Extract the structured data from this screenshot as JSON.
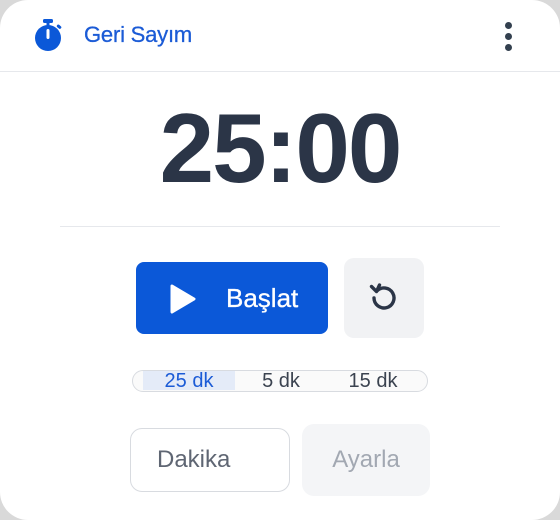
{
  "header": {
    "title": "Geri Sayım",
    "timer_icon": "stopwatch-icon",
    "menu_icon": "more-vertical-icon"
  },
  "timer": {
    "display": "25:00"
  },
  "controls": {
    "start_label": "Başlat",
    "start_icon": "play-icon",
    "reset_icon": "reset-icon"
  },
  "presets": {
    "items": [
      {
        "label": "25 dk",
        "active": true
      },
      {
        "label": "5 dk",
        "active": false
      },
      {
        "label": "15 dk",
        "active": false
      }
    ]
  },
  "custom": {
    "placeholder": "Dakika",
    "value": "",
    "set_label": "Ayarla"
  },
  "colors": {
    "accent": "#0b58d8",
    "title": "#1b5bd6",
    "timer_text": "#2b3547",
    "card_bg": "#ffffff",
    "page_bg": "#d9d9d9"
  }
}
